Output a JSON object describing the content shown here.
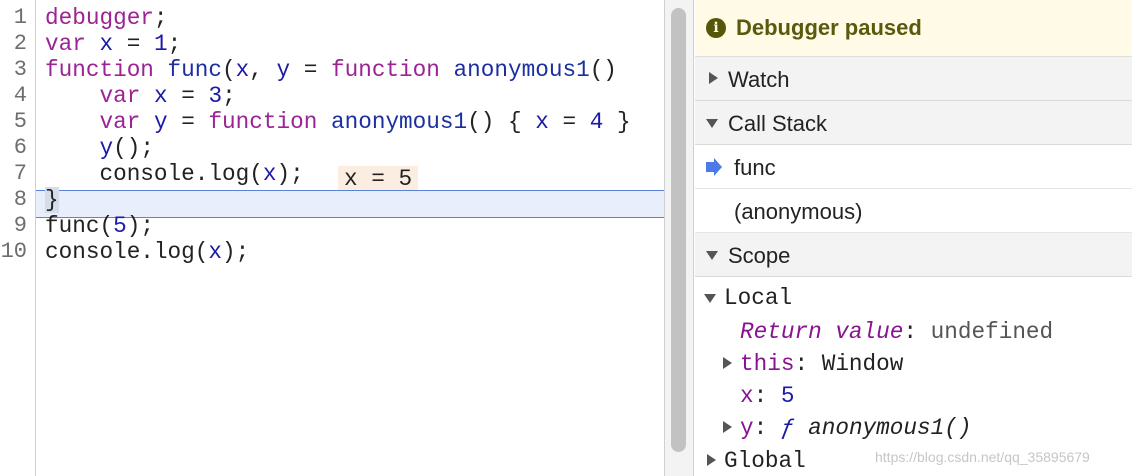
{
  "editor": {
    "line_numbers": [
      "1",
      "2",
      "3",
      "4",
      "5",
      "6",
      "7",
      "8",
      "9",
      "10"
    ],
    "lines": [
      [
        {
          "t": "debugger",
          "c": "kw"
        },
        {
          "t": ";",
          "c": "plain"
        }
      ],
      [
        {
          "t": "var",
          "c": "kw"
        },
        {
          "t": " ",
          "c": "plain"
        },
        {
          "t": "x",
          "c": "vr"
        },
        {
          "t": " = ",
          "c": "plain"
        },
        {
          "t": "1",
          "c": "num"
        },
        {
          "t": ";",
          "c": "plain"
        }
      ],
      [
        {
          "t": "function",
          "c": "kw"
        },
        {
          "t": " ",
          "c": "plain"
        },
        {
          "t": "func",
          "c": "fn"
        },
        {
          "t": "(",
          "c": "plain"
        },
        {
          "t": "x",
          "c": "vr"
        },
        {
          "t": ", ",
          "c": "plain"
        },
        {
          "t": "y",
          "c": "vr"
        },
        {
          "t": " = ",
          "c": "plain"
        },
        {
          "t": "function",
          "c": "kw"
        },
        {
          "t": " ",
          "c": "plain"
        },
        {
          "t": "anonymous1",
          "c": "fn"
        },
        {
          "t": "()",
          "c": "plain"
        }
      ],
      [
        {
          "t": "    ",
          "c": "plain"
        },
        {
          "t": "var",
          "c": "kw"
        },
        {
          "t": " ",
          "c": "plain"
        },
        {
          "t": "x",
          "c": "vr"
        },
        {
          "t": " = ",
          "c": "plain"
        },
        {
          "t": "3",
          "c": "num"
        },
        {
          "t": ";",
          "c": "plain"
        }
      ],
      [
        {
          "t": "    ",
          "c": "plain"
        },
        {
          "t": "var",
          "c": "kw"
        },
        {
          "t": " ",
          "c": "plain"
        },
        {
          "t": "y",
          "c": "vr"
        },
        {
          "t": " = ",
          "c": "plain"
        },
        {
          "t": "function",
          "c": "kw"
        },
        {
          "t": " ",
          "c": "plain"
        },
        {
          "t": "anonymous1",
          "c": "fn"
        },
        {
          "t": "() { ",
          "c": "plain"
        },
        {
          "t": "x",
          "c": "vr"
        },
        {
          "t": " = ",
          "c": "plain"
        },
        {
          "t": "4",
          "c": "num"
        },
        {
          "t": " }",
          "c": "plain"
        }
      ],
      [
        {
          "t": "    ",
          "c": "plain"
        },
        {
          "t": "y",
          "c": "vr"
        },
        {
          "t": "();",
          "c": "plain"
        }
      ],
      [
        {
          "t": "    console.log(",
          "c": "plain"
        },
        {
          "t": "x",
          "c": "vr"
        },
        {
          "t": ");",
          "c": "plain"
        }
      ],
      [
        {
          "t": "}",
          "c": "brace-box"
        }
      ],
      [
        {
          "t": "func(",
          "c": "plain"
        },
        {
          "t": "5",
          "c": "num"
        },
        {
          "t": ");",
          "c": "plain"
        }
      ],
      [
        {
          "t": "console.log(",
          "c": "plain"
        },
        {
          "t": "x",
          "c": "vr"
        },
        {
          "t": ");",
          "c": "plain"
        }
      ]
    ],
    "inline_value": "x = 5"
  },
  "sidebar": {
    "paused_banner": "Debugger paused",
    "watch_label": "Watch",
    "call_stack_label": "Call Stack",
    "call_stack": [
      "func",
      "(anonymous)"
    ],
    "scope_label": "Scope",
    "scope": {
      "local_label": "Local",
      "return_key": "Return value",
      "return_sep": ": ",
      "return_val": "undefined",
      "this_key": "this",
      "this_sep": ": ",
      "this_val": "Window",
      "x_key": "x",
      "x_sep": ": ",
      "x_val": "5",
      "y_key": "y",
      "y_sep": ": ",
      "y_f": "ƒ",
      "y_val": " anonymous1()",
      "global_label": "Global"
    }
  },
  "watermark": "https://blog.csdn.net/qq_35895679",
  "colors": {
    "paused_line_bg": "#e8eefc",
    "paused_line_border": "#5a82d8",
    "banner_bg": "#fffbe6",
    "current_frame_arrow": "#4c7be8"
  }
}
